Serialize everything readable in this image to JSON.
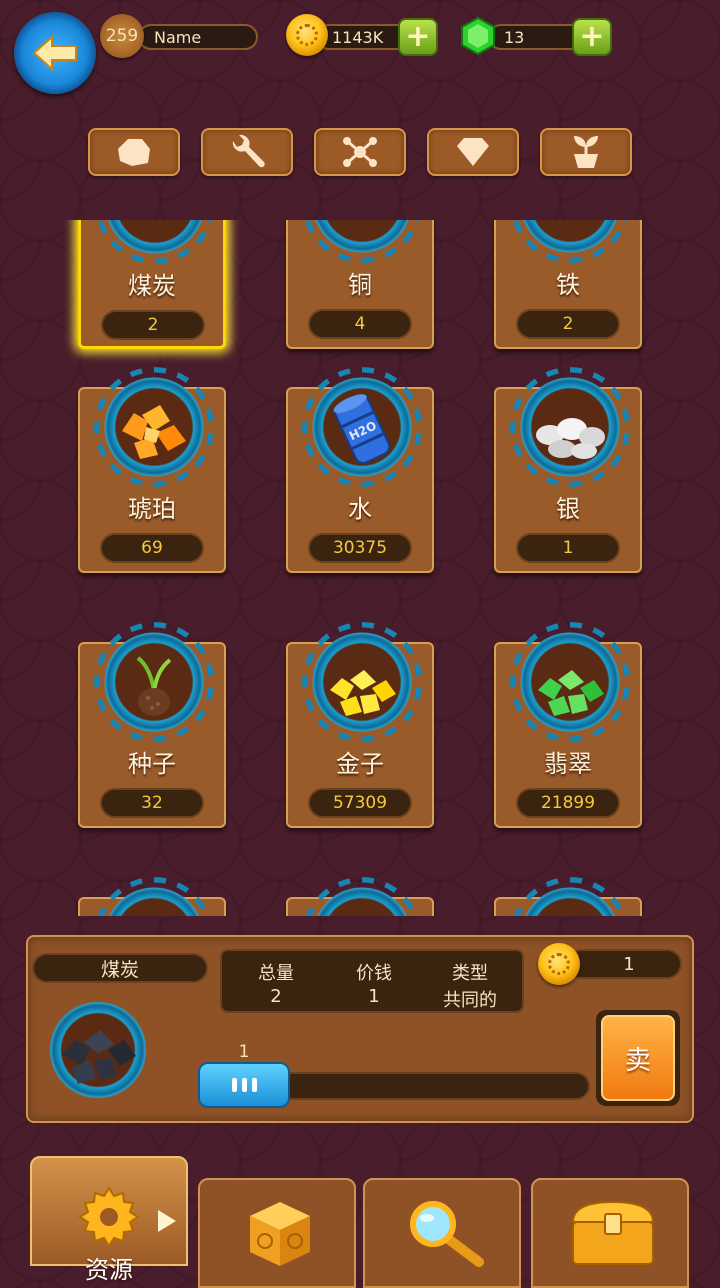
{
  "header": {
    "level": "259",
    "player_name": "Name",
    "coins": "1143K",
    "gems": "13"
  },
  "tabs": [
    {
      "icon": "rock-icon"
    },
    {
      "icon": "wrench-icon"
    },
    {
      "icon": "molecule-icon"
    },
    {
      "icon": "diamond-icon"
    },
    {
      "icon": "plant-icon"
    }
  ],
  "resources": [
    {
      "name": "煤炭",
      "count": "2",
      "selected": true
    },
    {
      "name": "铜",
      "count": "4"
    },
    {
      "name": "铁",
      "count": "2"
    },
    {
      "name": "琥珀",
      "count": "69"
    },
    {
      "name": "水",
      "count": "30375"
    },
    {
      "name": "银",
      "count": "1"
    },
    {
      "name": "种子",
      "count": "32"
    },
    {
      "name": "金子",
      "count": "57309"
    },
    {
      "name": "翡翠",
      "count": "21899"
    }
  ],
  "detail": {
    "name": "煤炭",
    "total_label": "总量",
    "total_value": "2",
    "price_label": "价钱",
    "price_value": "1",
    "type_label": "类型",
    "type_value": "共同的",
    "sell_price": "1",
    "quantity": "1",
    "sell_label": "卖"
  },
  "bottom_nav": {
    "resources_label": "资源"
  },
  "colors": {
    "background": "#4a1d2c",
    "panel": "#8e5226",
    "count_text": "#f5c93c",
    "sell_button": "#f07a10",
    "slider": "#1a8fd6"
  }
}
